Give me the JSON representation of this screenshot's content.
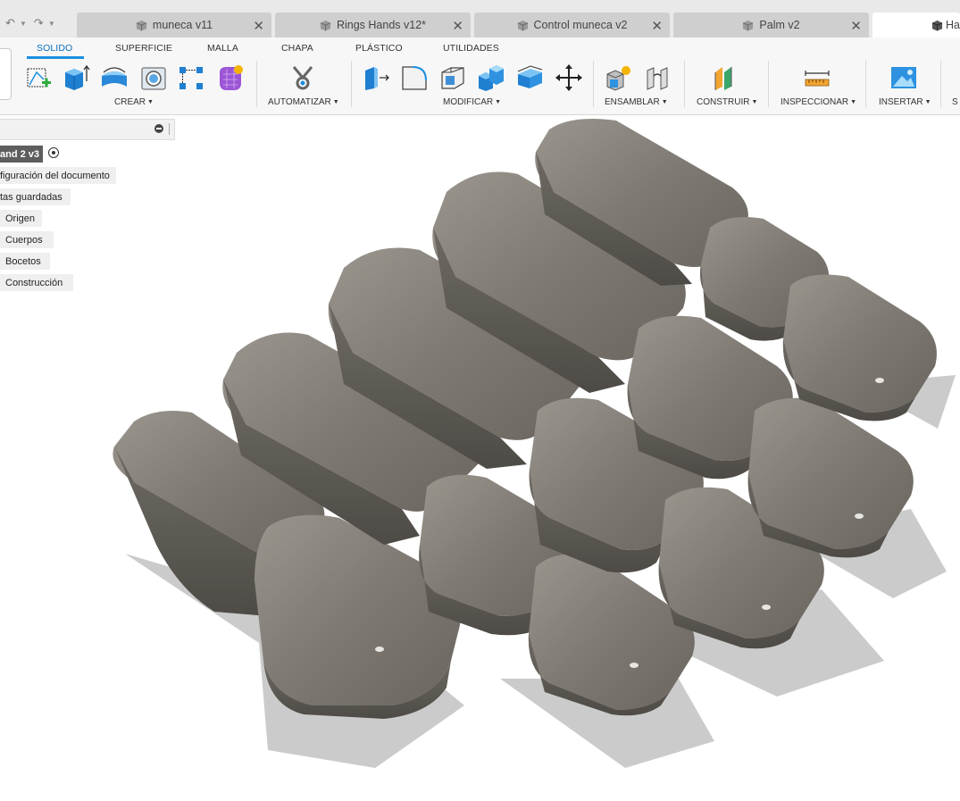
{
  "tabs": [
    {
      "label": "muneca v11"
    },
    {
      "label": "Rings Hands v12*"
    },
    {
      "label": "Control muneca v2"
    },
    {
      "label": "Palm v2"
    },
    {
      "label": "Ha"
    }
  ],
  "ribbon": {
    "tabs": [
      "SOLIDO",
      "SUPERFICIE",
      "MALLA",
      "CHAPA",
      "PLÁSTICO",
      "UTILIDADES"
    ],
    "groups": {
      "crear": "CREAR",
      "automatizar": "AUTOMATIZAR",
      "modificar": "MODIFICAR",
      "ensamblar": "ENSAMBLAR",
      "construir": "CONSTRUIR",
      "inspeccionar": "INSPECCIONAR",
      "insertar": "INSERTAR",
      "next": "S"
    }
  },
  "browser": {
    "root": "and 2 v3",
    "items": [
      "figuración del documento",
      "tas guardadas",
      "Origen",
      "Cuerpos",
      "Bocetos",
      "Construcción"
    ]
  },
  "colors": {
    "accent": "#1a8fe0",
    "body": "#85817a",
    "root_bg": "#5e5e5e"
  }
}
